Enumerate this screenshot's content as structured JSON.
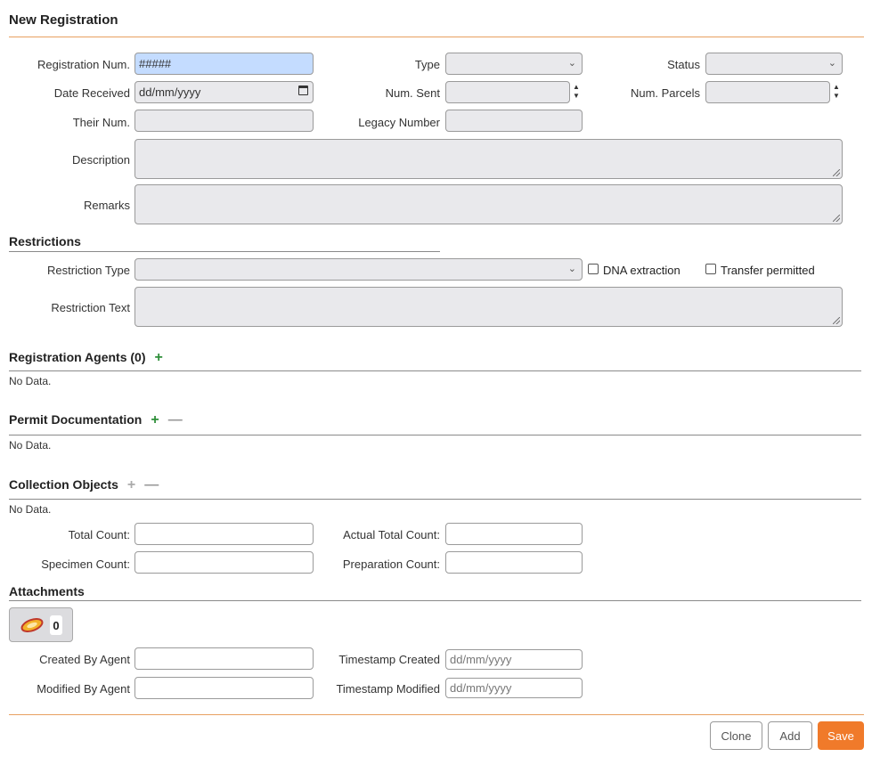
{
  "page_title": "New Registration",
  "fields": {
    "registration_num": {
      "label": "Registration Num.",
      "value": "#####"
    },
    "type": {
      "label": "Type",
      "value": ""
    },
    "status": {
      "label": "Status",
      "value": ""
    },
    "date_received": {
      "label": "Date Received",
      "placeholder": "dd/mm/yyyy"
    },
    "num_sent": {
      "label": "Num. Sent",
      "value": ""
    },
    "num_parcels": {
      "label": "Num. Parcels",
      "value": ""
    },
    "their_num": {
      "label": "Their Num.",
      "value": ""
    },
    "legacy_number": {
      "label": "Legacy Number",
      "value": ""
    },
    "description": {
      "label": "Description",
      "value": ""
    },
    "remarks": {
      "label": "Remarks",
      "value": ""
    }
  },
  "restrictions": {
    "heading": "Restrictions",
    "type_label": "Restriction Type",
    "type_value": "",
    "dna_label": "DNA extraction",
    "transfer_label": "Transfer permitted",
    "text_label": "Restriction Text"
  },
  "registration_agents": {
    "heading": "Registration Agents (0)",
    "add": "+",
    "empty": "No Data."
  },
  "permit_documentation": {
    "heading": "Permit Documentation",
    "add": "+",
    "remove": "—",
    "empty": "No Data."
  },
  "collection_objects": {
    "heading": "Collection Objects",
    "add": "+",
    "remove": "—",
    "empty": "No Data.",
    "total_count_label": "Total Count:",
    "actual_total_count_label": "Actual Total Count:",
    "specimen_count_label": "Specimen Count:",
    "preparation_count_label": "Preparation Count:"
  },
  "attachments": {
    "heading": "Attachments",
    "count": "0",
    "created_by_label": "Created By Agent",
    "modified_by_label": "Modified By Agent",
    "timestamp_created_label": "Timestamp Created",
    "timestamp_created_placeholder": "dd/mm/yyyy",
    "timestamp_modified_label": "Timestamp Modified",
    "timestamp_modified_placeholder": "dd/mm/yyyy"
  },
  "buttons": {
    "clone": "Clone",
    "add": "Add",
    "save": "Save"
  },
  "icons": {
    "attachment": "attachment-paperclip-icon",
    "dropdown": "chevron-down-icon",
    "calendar": "calendar-icon"
  },
  "colors": {
    "accent": "#f07a2a",
    "highlight_input": "#c4dcff",
    "add_green": "#2f8f3a"
  }
}
